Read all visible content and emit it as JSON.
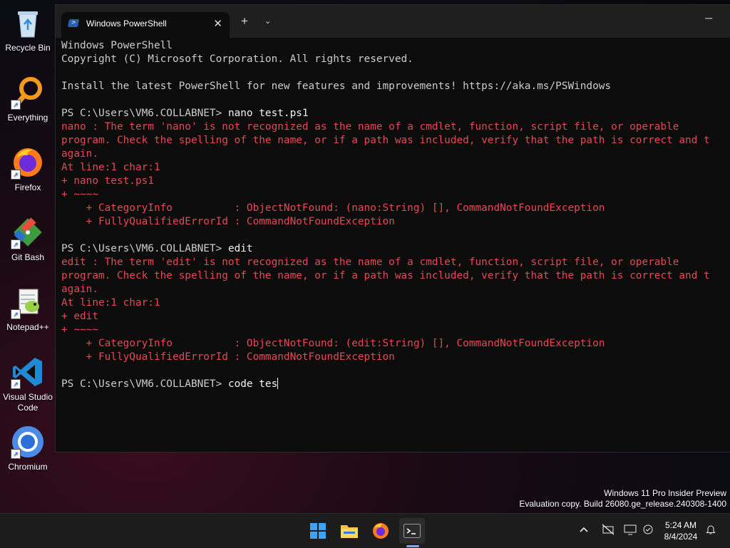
{
  "desktop": {
    "icons": [
      {
        "label": "Recycle Bin",
        "icon": "recycle-bin-icon"
      },
      {
        "label": "Everything",
        "icon": "everything-search-icon"
      },
      {
        "label": "Firefox",
        "icon": "firefox-icon"
      },
      {
        "label": "Git Bash",
        "icon": "git-bash-icon"
      },
      {
        "label": "Notepad++",
        "icon": "notepad-plus-plus-icon"
      },
      {
        "label": "Visual Studio Code",
        "icon": "vscode-icon"
      },
      {
        "label": "Chromium",
        "icon": "chromium-icon"
      }
    ]
  },
  "window": {
    "tab_title": "Windows PowerShell",
    "tab_icon": "powershell-icon",
    "close_glyph": "✕",
    "new_tab_glyph": "+",
    "dropdown_glyph": "⌄",
    "minimize_glyph": "─"
  },
  "console": {
    "lines": [
      {
        "text": "Windows PowerShell",
        "style": "normal"
      },
      {
        "text": "Copyright (C) Microsoft Corporation. All rights reserved.",
        "style": "normal"
      },
      {
        "text": "",
        "style": "normal"
      },
      {
        "text": "Install the latest PowerShell for new features and improvements! https://aka.ms/PSWindows",
        "style": "normal"
      },
      {
        "text": "",
        "style": "normal"
      },
      {
        "prompt": "PS C:\\Users\\VM6.COLLABNET> ",
        "cmd": "nano test.ps1",
        "style": "prompt"
      },
      {
        "text": "nano : The term 'nano' is not recognized as the name of a cmdlet, function, script file, or operable",
        "style": "err"
      },
      {
        "text": "program. Check the spelling of the name, or if a path was included, verify that the path is correct and t",
        "style": "err"
      },
      {
        "text": "again.",
        "style": "err"
      },
      {
        "text": "At line:1 char:1",
        "style": "err"
      },
      {
        "text": "+ nano test.ps1",
        "style": "err"
      },
      {
        "text": "+ ~~~~",
        "style": "err"
      },
      {
        "text": "    + CategoryInfo          : ObjectNotFound: (nano:String) [], CommandNotFoundException",
        "style": "err"
      },
      {
        "text": "    + FullyQualifiedErrorId : CommandNotFoundException",
        "style": "err"
      },
      {
        "text": "",
        "style": "normal"
      },
      {
        "prompt": "PS C:\\Users\\VM6.COLLABNET> ",
        "cmd": "edit",
        "style": "prompt"
      },
      {
        "text": "edit : The term 'edit' is not recognized as the name of a cmdlet, function, script file, or operable",
        "style": "err"
      },
      {
        "text": "program. Check the spelling of the name, or if a path was included, verify that the path is correct and t",
        "style": "err"
      },
      {
        "text": "again.",
        "style": "err"
      },
      {
        "text": "At line:1 char:1",
        "style": "err"
      },
      {
        "text": "+ edit",
        "style": "err"
      },
      {
        "text": "+ ~~~~",
        "style": "err"
      },
      {
        "text": "    + CategoryInfo          : ObjectNotFound: (edit:String) [], CommandNotFoundException",
        "style": "err"
      },
      {
        "text": "    + FullyQualifiedErrorId : CommandNotFoundException",
        "style": "err"
      },
      {
        "text": "",
        "style": "normal"
      },
      {
        "prompt": "PS C:\\Users\\VM6.COLLABNET> ",
        "cmd": "code tes",
        "style": "prompt-active"
      }
    ]
  },
  "watermark": {
    "line1": "Windows 11 Pro Insider Preview",
    "line2": "Evaluation copy. Build 26080.ge_release.240308-1400"
  },
  "taskbar": {
    "apps": [
      "start-icon",
      "file-explorer-icon",
      "firefox-icon",
      "terminal-icon"
    ],
    "tray": [
      "chevron-up-icon",
      "network-off-icon",
      "display-icon",
      "accessibility-icon",
      "notification-bell-icon"
    ],
    "time": "5:24 AM",
    "date": "8/4/2024"
  },
  "colors": {
    "error": "#e74856",
    "text": "#cccccc",
    "console_bg": "#0c0c0c",
    "taskbar_bg": "#1c1c1c"
  }
}
